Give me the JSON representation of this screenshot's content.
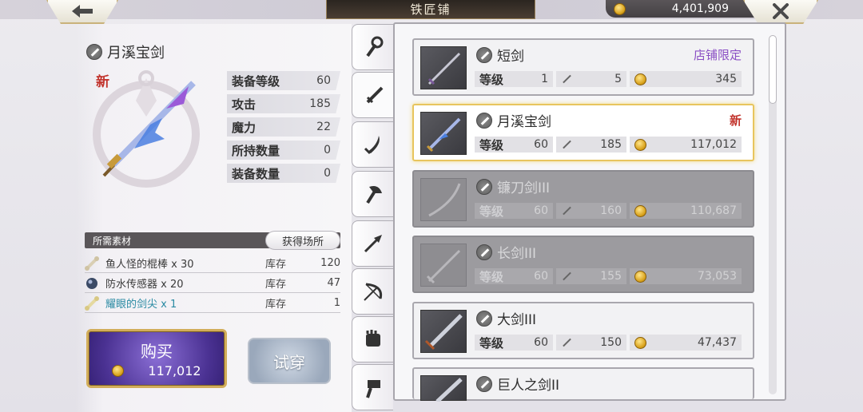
{
  "header": {
    "title": "铁匠铺",
    "gold": "4,401,909",
    "back_icon": "arrow-left-icon",
    "close_icon": "close-icon"
  },
  "item": {
    "name": "月溪宝剑",
    "new_tag": "新",
    "stats": [
      {
        "label": "装备等级",
        "value": "60"
      },
      {
        "label": "攻击",
        "value": "185"
      },
      {
        "label": "魔力",
        "value": "22"
      },
      {
        "label": "所持数量",
        "value": "0"
      },
      {
        "label": "装备数量",
        "value": "0"
      }
    ]
  },
  "materials": {
    "header": "所需素材",
    "where_button": "获得场所",
    "rows": [
      {
        "name": "鱼人怪的棍棒 x 30",
        "stock_label": "库存",
        "stock": "120",
        "icon": "bone-icon"
      },
      {
        "name": "防水传感器 x 20",
        "stock_label": "库存",
        "stock": "47",
        "icon": "orb-icon"
      },
      {
        "name": "耀眼的剑尖 x 1",
        "stock_label": "库存",
        "stock": "1",
        "icon": "bone-icon"
      }
    ]
  },
  "actions": {
    "buy_label": "购买",
    "buy_price": "117,012",
    "try_label": "试穿"
  },
  "tabs": [
    {
      "icon": "staff-icon"
    },
    {
      "icon": "sword-icon"
    },
    {
      "icon": "blade-icon"
    },
    {
      "icon": "axe-icon"
    },
    {
      "icon": "spear-icon"
    },
    {
      "icon": "bow-icon"
    },
    {
      "icon": "fist-icon"
    },
    {
      "icon": "hammer-icon"
    }
  ],
  "list": [
    {
      "name": "短剑",
      "tag": "店铺限定",
      "level_label": "等级",
      "level": "1",
      "attack": "5",
      "price": "345",
      "state": "normal"
    },
    {
      "name": "月溪宝剑",
      "tag": "新",
      "level_label": "等级",
      "level": "60",
      "attack": "185",
      "price": "117,012",
      "state": "selected"
    },
    {
      "name": "镰刀剑III",
      "tag": "",
      "level_label": "等级",
      "level": "60",
      "attack": "160",
      "price": "110,687",
      "state": "disabled"
    },
    {
      "name": "长剑III",
      "tag": "",
      "level_label": "等级",
      "level": "60",
      "attack": "155",
      "price": "73,053",
      "state": "disabled"
    },
    {
      "name": "大剑III",
      "tag": "",
      "level_label": "等级",
      "level": "60",
      "attack": "150",
      "price": "47,437",
      "state": "normal"
    },
    {
      "name": "巨人之剑II",
      "tag": "",
      "level_label": "",
      "level": "",
      "attack": "",
      "price": "",
      "state": "normal"
    }
  ],
  "colors": {
    "accent_gold": "#d2ad5a",
    "buy_purple": "#4b3293",
    "new_red": "#c2352e",
    "limited_purple": "#8a4fc4"
  }
}
